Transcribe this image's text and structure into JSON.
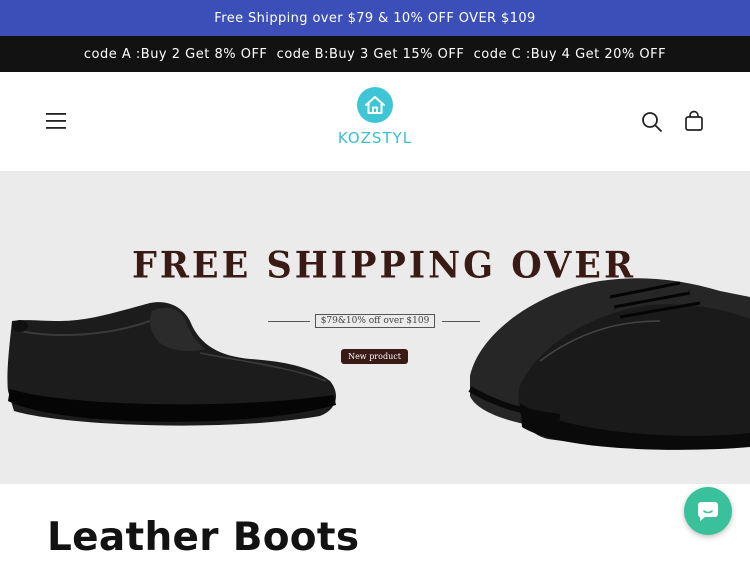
{
  "announcements": {
    "top": "Free Shipping over $79 & 10% OFF OVER $109",
    "codes": "code A :Buy 2 Get 8% OFF  code B:Buy 3 Get 15% OFF  code C :Buy 4 Get 20% OFF"
  },
  "header": {
    "menu_icon": "hamburger-icon",
    "logo_text": "KOZSTYL",
    "logo_icon": "house-icon",
    "search_icon": "search-icon",
    "cart_icon": "cart-icon"
  },
  "banner": {
    "title": "FREE SHIPPING OVER",
    "subtitle": "$79&10% off over $109",
    "badge": "New product"
  },
  "main": {
    "collection_title": "Leather Boots"
  },
  "chat": {
    "icon": "chat-bubble-icon"
  },
  "colors": {
    "announcement_blue": "#3c4fb8",
    "announcement_black": "#121212",
    "logo_teal": "#3bc0d0",
    "banner_bg": "#ebebeb",
    "banner_text": "#3a1a14",
    "chat_green": "#3ac19b"
  }
}
